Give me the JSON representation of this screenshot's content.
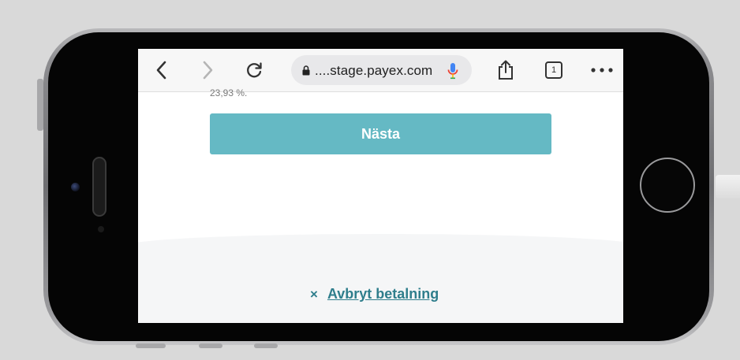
{
  "browser": {
    "url": "....stage.payex.com",
    "tab_count": "1"
  },
  "page": {
    "clipped_text": "23,93 %.",
    "next_button_label": "Nästa",
    "cancel_icon": "×",
    "cancel_label": "Avbryt betalning"
  },
  "colors": {
    "primary_button": "#65b9c4",
    "link": "#2f7e8c"
  },
  "icons": [
    "back-icon",
    "forward-icon",
    "reload-icon",
    "lock-icon",
    "microphone-icon",
    "share-icon",
    "tabs-icon",
    "more-icon"
  ]
}
